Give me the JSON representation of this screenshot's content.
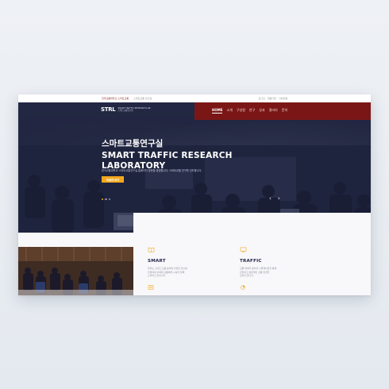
{
  "topbar": {
    "left": [
      "한국교통대학교 스마트교통",
      "스마트교통 연구실"
    ],
    "right": [
      "로그인",
      "회원가입",
      "사이트맵"
    ]
  },
  "logo": {
    "mark": "STRL",
    "sub_line1": "SMART TRAFFIC RESEARCH LAB",
    "sub_line2": "스마트교통연구실"
  },
  "nav": {
    "items": [
      "HOME",
      "소개",
      "구성원",
      "연구",
      "성과",
      "갤러리",
      "문의"
    ]
  },
  "hero": {
    "title_kr": "스마트교통연구실",
    "title_en_line1": "SMART TRAFFIC RESEARCH",
    "title_en_line2": "LABORATORY",
    "description": "한국교통대학교 스마트교통연구실 홈페이지 방문을 환영합니다. 스마트교통 연구를 선도합니다.",
    "button": "자세히 보기",
    "prev_arrow": "‹",
    "next_arrow": "›",
    "slides": 3,
    "active_slide": 1
  },
  "cards": [
    {
      "name": "SMART",
      "desc": [
        "우리는 스마트 교통 분야의 다양한 연구를",
        "진행하며 차세대 교통체계 구축을 위해",
        "노력하고 있습니다."
      ]
    },
    {
      "name": "TRAFFIC",
      "desc": [
        "교통 데이터 분석과 시뮬레이션을 통해",
        "안전하고 효율적인 교통 환경을",
        "만들어 갑니다."
      ]
    }
  ],
  "colors": {
    "nav_bg": "#7b1616",
    "accent": "#f2a81d",
    "navy": "#22264a"
  }
}
